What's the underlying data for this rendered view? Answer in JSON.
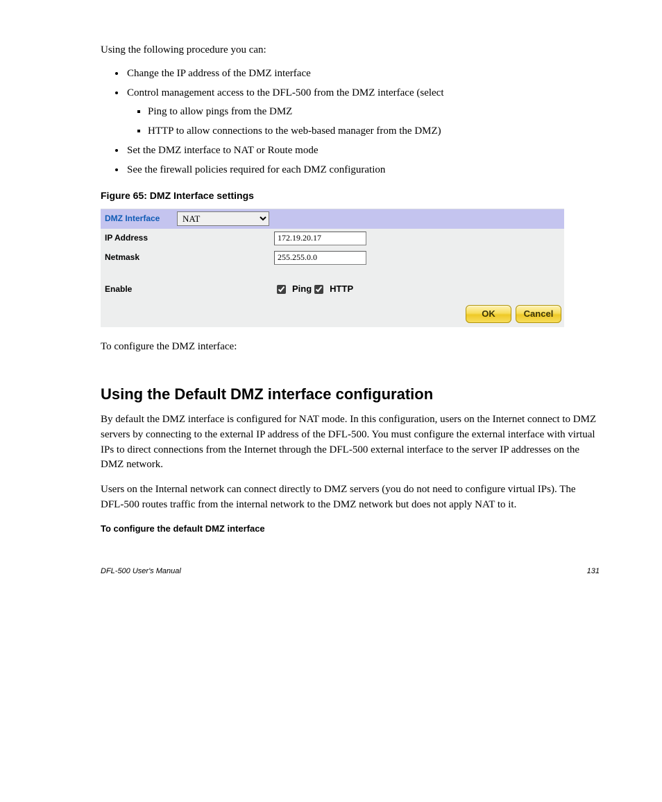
{
  "intro": "Using the following procedure you can:",
  "bullets": {
    "b1": "Change the IP address of the DMZ interface",
    "b2": "Control management access to the DFL-500 from the DMZ interface (select",
    "b2_inner1": "Ping to allow pings from the DMZ",
    "b2_inner2": "HTTP to allow connections to the web-based manager from the DMZ)",
    "b3": "Set the DMZ interface to NAT or Route mode",
    "b4": "See the firewall policies required for each DMZ configuration"
  },
  "figcap": "Figure 65: DMZ Interface settings",
  "panel": {
    "header_label": "DMZ Interface",
    "mode_option": "NAT",
    "ip_label": "IP Address",
    "ip_value": "172.19.20.17",
    "netmask_label": "Netmask",
    "netmask_value": "255.255.0.0",
    "enable_label": "Enable",
    "ping_label": "Ping",
    "http_label": "HTTP",
    "ok_label": "OK",
    "cancel_label": "Cancel"
  },
  "afterfig": "To configure the DMZ interface:",
  "section": {
    "title": "Using the Default DMZ interface configuration",
    "p1": "By default the DMZ interface is configured for NAT mode. In this configuration, users on the Internet connect to DMZ servers by connecting to the external IP address of the DFL-500. You must configure the external interface with virtual IPs to direct connections from the Internet through the DFL-500 external interface to the server IP addresses on the DMZ network.",
    "p2": "Users on the Internal network can connect directly to DMZ servers (you do not need to configure virtual IPs). The DFL-500 routes traffic from the internal network to the DMZ network but does not apply NAT to it.",
    "steps_title": "To configure the default DMZ interface"
  },
  "footer": {
    "left": "DFL-500 User's Manual",
    "right": "131"
  }
}
